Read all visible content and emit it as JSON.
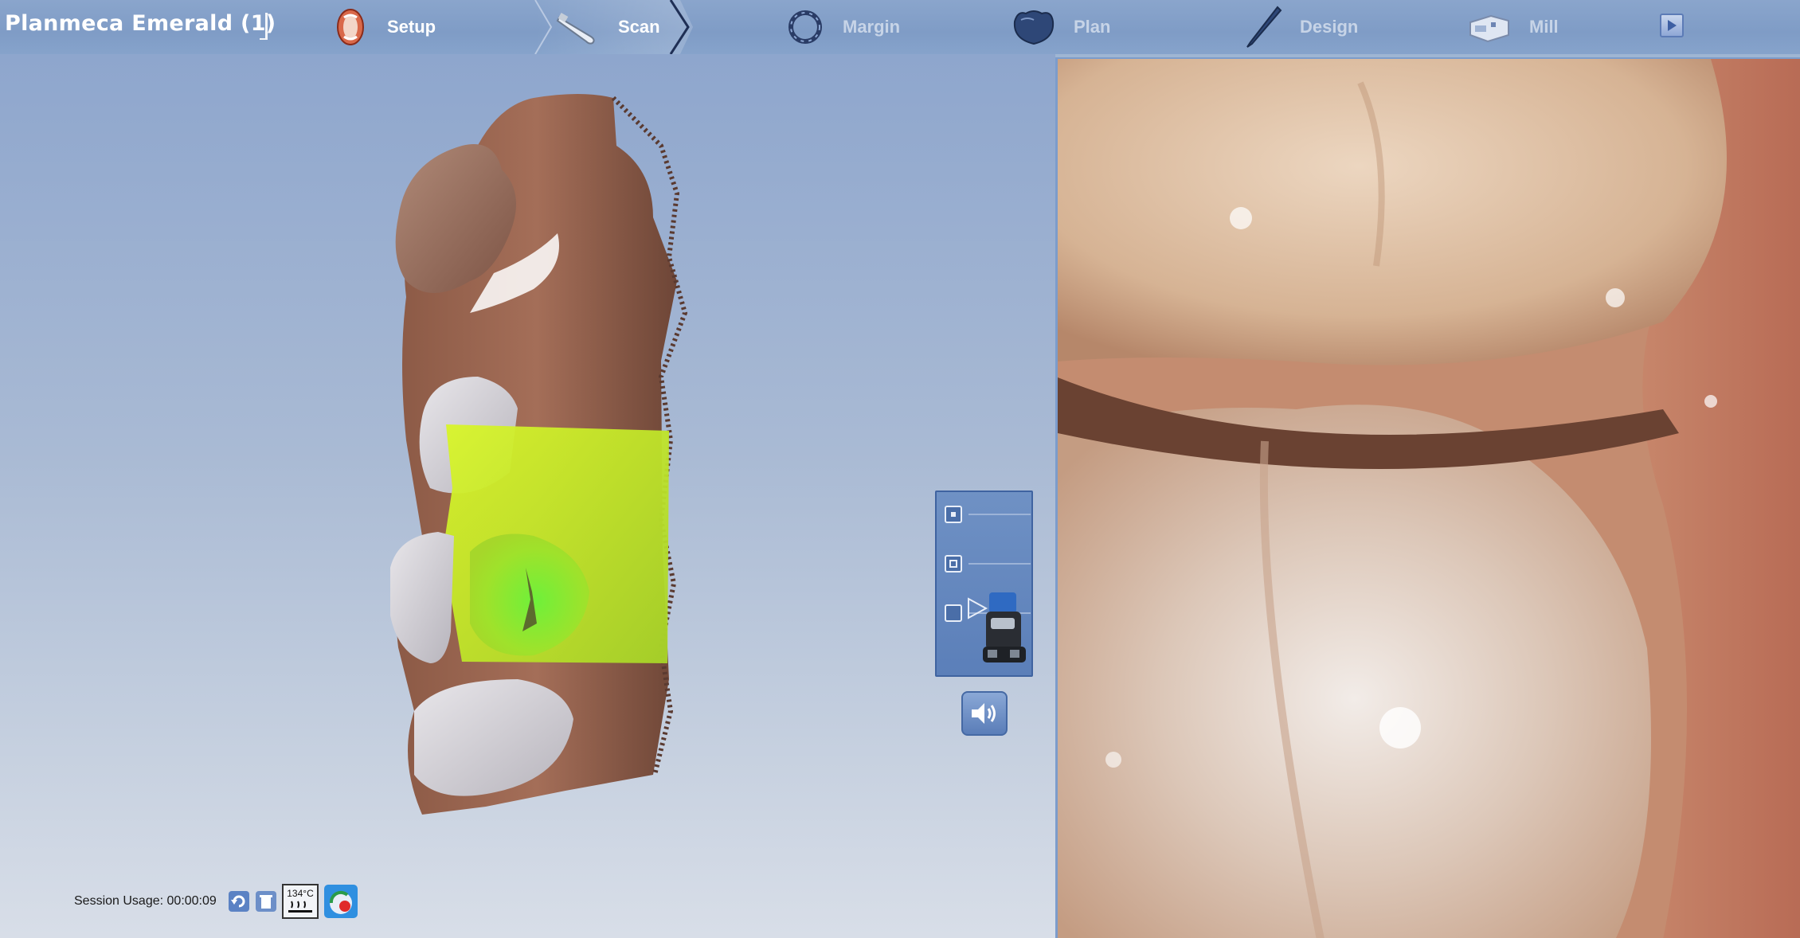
{
  "app": {
    "title": "Planmeca Emerald (1)"
  },
  "workflow": {
    "steps": [
      {
        "label": "Setup",
        "icon": "jaw-icon",
        "state": "done"
      },
      {
        "label": "Scan",
        "icon": "scanner-wand-icon",
        "state": "active"
      },
      {
        "label": "Margin",
        "icon": "margin-ring-icon",
        "state": "inactive"
      },
      {
        "label": "Plan",
        "icon": "crown-icon",
        "state": "inactive"
      },
      {
        "label": "Design",
        "icon": "design-pen-icon",
        "state": "inactive"
      },
      {
        "label": "Mill",
        "icon": "mill-machine-icon",
        "state": "inactive"
      }
    ],
    "next_icon": "play-icon"
  },
  "scan_panel": {
    "options": [
      {
        "icon": "small-square-icon"
      },
      {
        "icon": "medium-square-icon"
      },
      {
        "icon": "bite-scan-icon"
      }
    ],
    "scanner_icon": "scanner-head-icon",
    "sound_icon": "speaker-icon"
  },
  "status": {
    "session_usage_label": "Session Usage:",
    "session_usage_value": "00:00:09",
    "sterilize_temp": "134°C",
    "icons": [
      "refresh-icon",
      "trash-icon",
      "autoclave-icon",
      "tip-status-icon"
    ]
  },
  "colors": {
    "active_step": "#ffffff",
    "inactive_step": "#c7d4e7",
    "highlight_green": "#9be02a",
    "panel_blue": "#5b7fb9"
  }
}
